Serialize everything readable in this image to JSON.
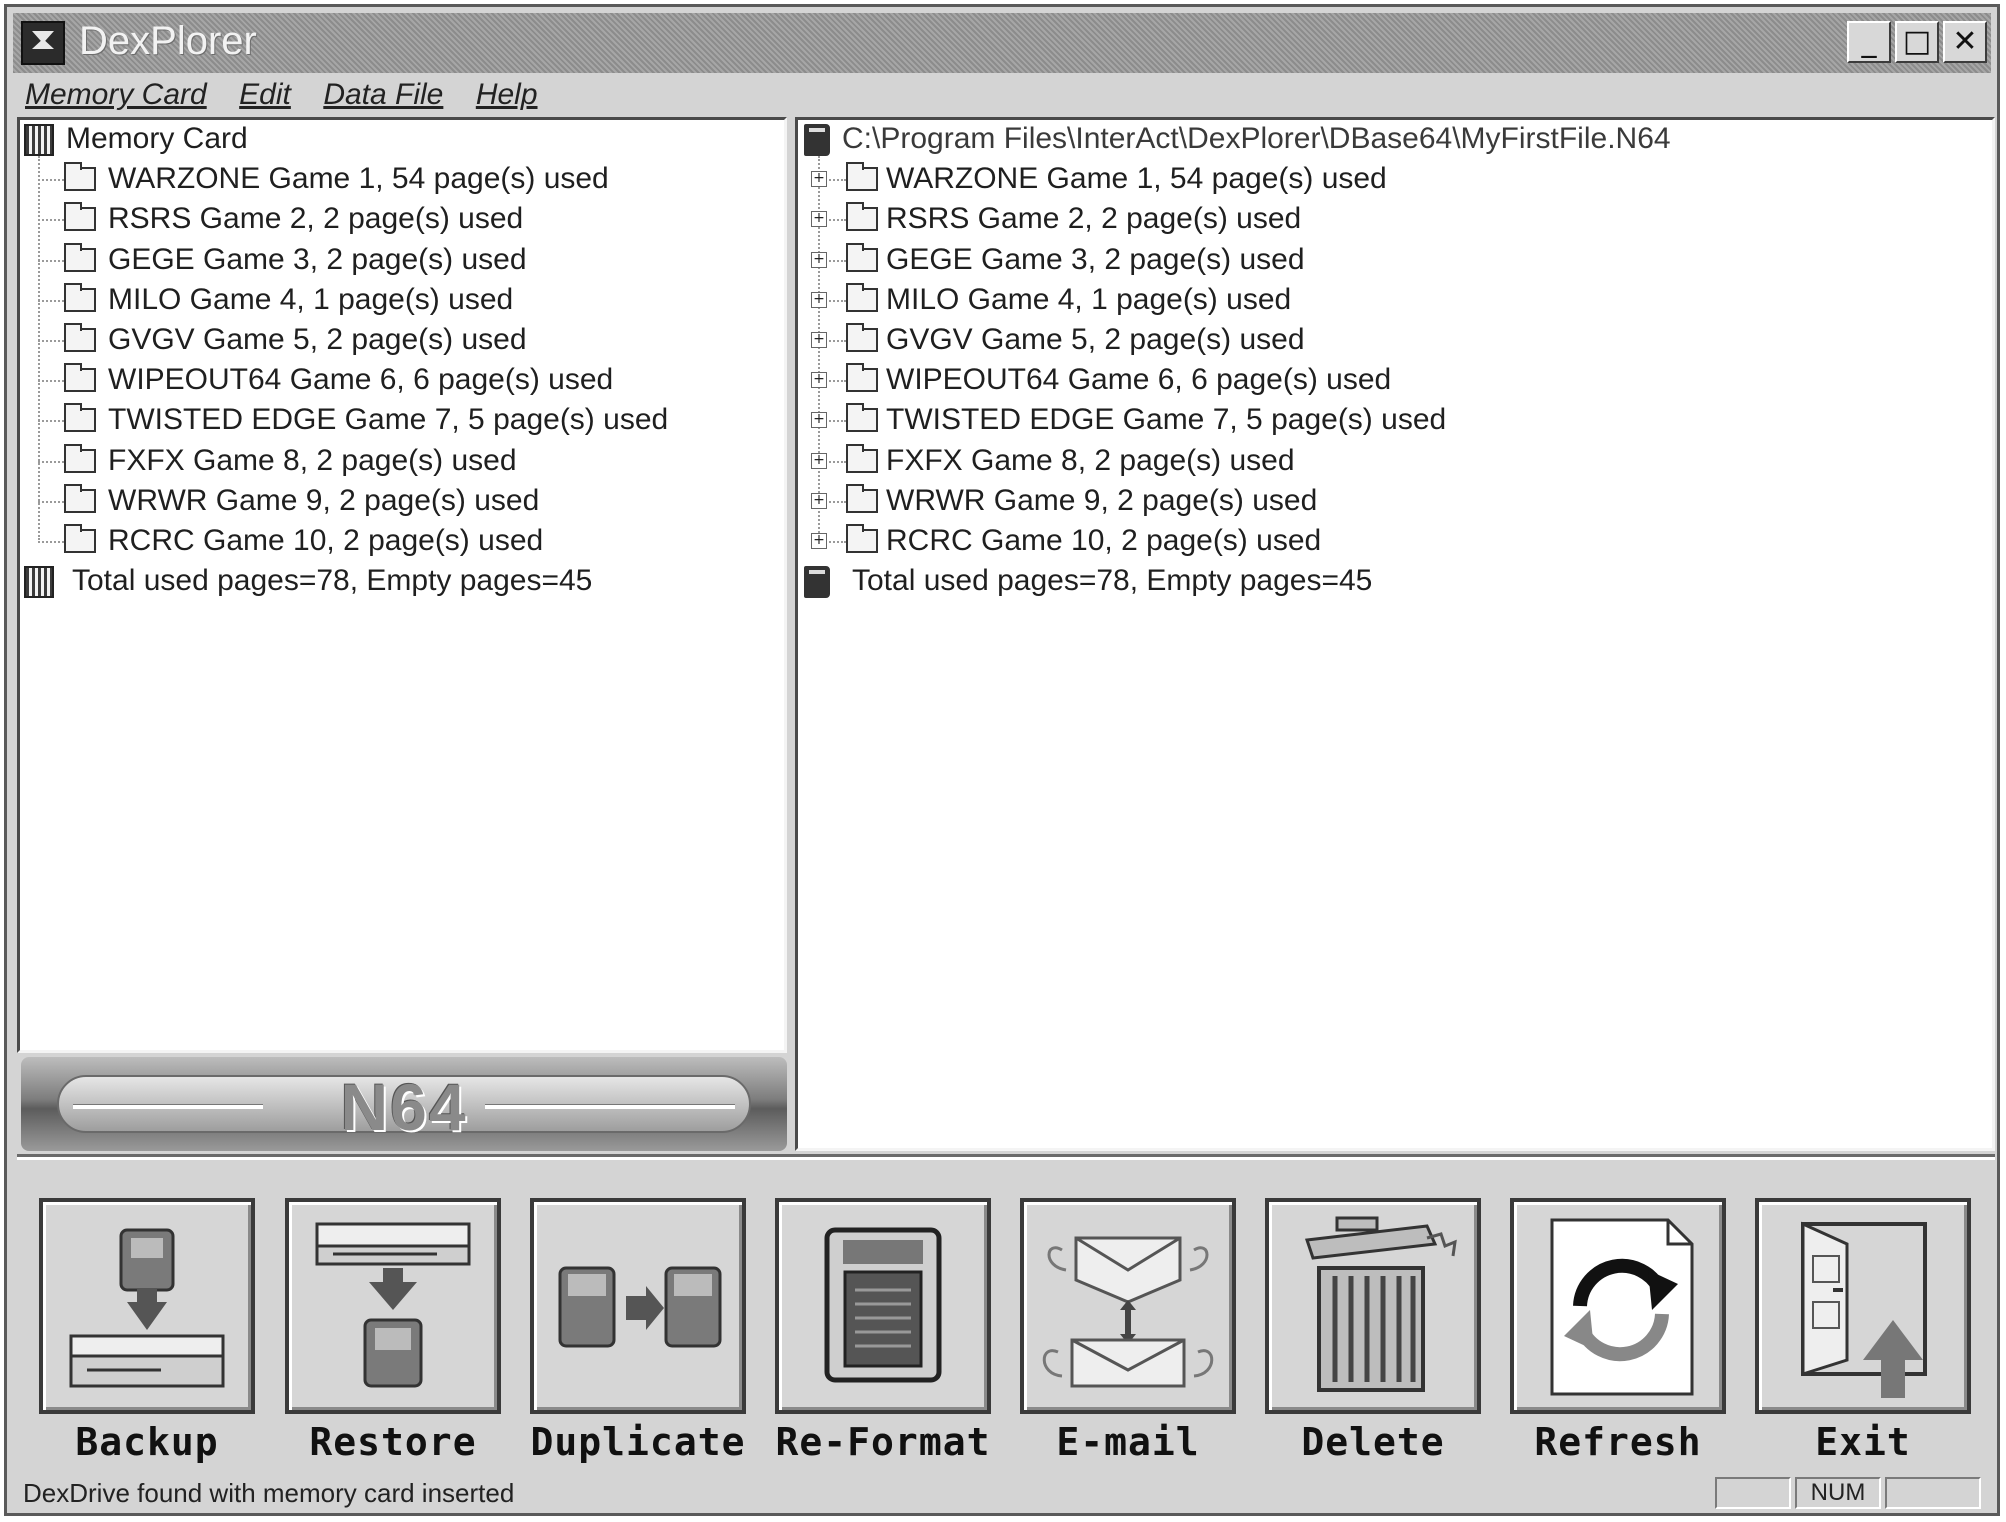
{
  "window": {
    "title": "DexPlorer",
    "minimize_glyph": "_",
    "maximize_glyph": "□",
    "close_glyph": "✕"
  },
  "menu": [
    "Memory Card",
    "Edit",
    "Data File",
    "Help"
  ],
  "left_tree": {
    "root": "Memory Card",
    "items": [
      "WARZONE Game 1, 54 page(s) used",
      "RSRS Game 2, 2 page(s) used",
      "GEGE Game 3, 2 page(s) used",
      "MILO  Game 4, 1 page(s) used",
      "GVGV Game 5, 2 page(s) used",
      "WIPEOUT64 Game 6, 6 page(s) used",
      "TWISTED EDGE Game 7, 5 page(s) used",
      "FXFX Game 8, 2 page(s) used",
      "WRWR Game 9, 2 page(s) used",
      "RCRC Game 10, 2 page(s) used"
    ],
    "total": "Total used pages=78, Empty pages=45"
  },
  "right_tree": {
    "root": "C:\\Program Files\\InterAct\\DexPlorer\\DBase64\\MyFirstFile.N64",
    "items": [
      "WARZONE Game 1, 54 page(s) used",
      "RSRS Game 2, 2 page(s) used",
      "GEGE Game 3, 2 page(s) used",
      "MILO  Game 4, 1 page(s) used",
      "GVGV Game 5, 2 page(s) used",
      "WIPEOUT64 Game 6, 6 page(s) used",
      "TWISTED EDGE Game 7, 5 page(s) used",
      "FXFX Game 8, 2 page(s) used",
      "WRWR Game 9, 2 page(s) used",
      "RCRC Game 10, 2 page(s) used"
    ],
    "total": "Total used pages=78, Empty pages=45"
  },
  "n64_logo": "N64",
  "toolbar": [
    {
      "id": "backup",
      "label": "Backup",
      "icon": "backup-icon"
    },
    {
      "id": "restore",
      "label": "Restore",
      "icon": "restore-icon"
    },
    {
      "id": "duplicate",
      "label": "Duplicate",
      "icon": "duplicate-icon"
    },
    {
      "id": "reformat",
      "label": "Re-Format",
      "icon": "reformat-icon"
    },
    {
      "id": "email",
      "label": "E-mail",
      "icon": "email-icon"
    },
    {
      "id": "delete",
      "label": "Delete",
      "icon": "delete-icon"
    },
    {
      "id": "refresh",
      "label": "Refresh",
      "icon": "refresh-icon"
    },
    {
      "id": "exit",
      "label": "Exit",
      "icon": "exit-icon"
    }
  ],
  "status": {
    "message": "DexDrive found with memory card inserted",
    "num": "NUM"
  }
}
